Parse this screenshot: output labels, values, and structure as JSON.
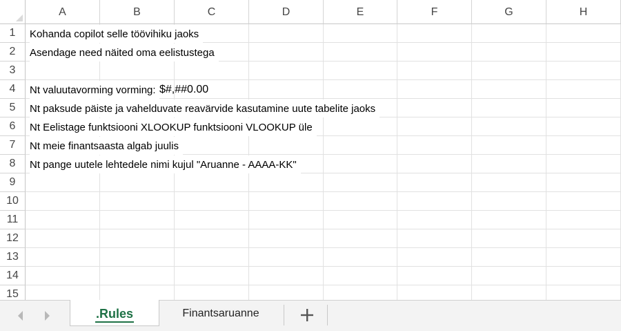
{
  "sheet": {
    "columns": [
      "A",
      "B",
      "C",
      "D",
      "E",
      "F",
      "G",
      "H"
    ],
    "rows": [
      "1",
      "2",
      "3",
      "4",
      "5",
      "6",
      "7",
      "8",
      "9",
      "10",
      "11",
      "12",
      "13",
      "14",
      "15"
    ],
    "cells": {
      "A1": "Kohanda copilot selle töövihiku jaoks",
      "A2": "Asendage need näited oma eelistustega",
      "A4": "Nt valuutavorming vorming: ",
      "A4_code": "$#,##0.00",
      "A5": "Nt paksude päiste ja vahelduvate reavärvide kasutamine uute tabelite jaoks",
      "A6": "Nt Eelistage funktsiooni XLOOKUP funktsiooni VLOOKUP üle",
      "A7": "Nt meie finantsaasta algab juulis",
      "A8": "Nt pange uutele lehtedele nimi kujul \"Aruanne - AAAA-KK\""
    }
  },
  "tabs": {
    "items": [
      {
        "label": ".Rules",
        "active": true
      },
      {
        "label": "Finantsaruanne",
        "active": false
      }
    ],
    "add_label": "+"
  },
  "colors": {
    "active_tab": "#1e7145",
    "gridline": "#e1e1e1",
    "header_text": "#444444"
  },
  "icons": {
    "prev": "chevron-left-icon",
    "next": "chevron-right-icon",
    "add": "plus-icon"
  }
}
